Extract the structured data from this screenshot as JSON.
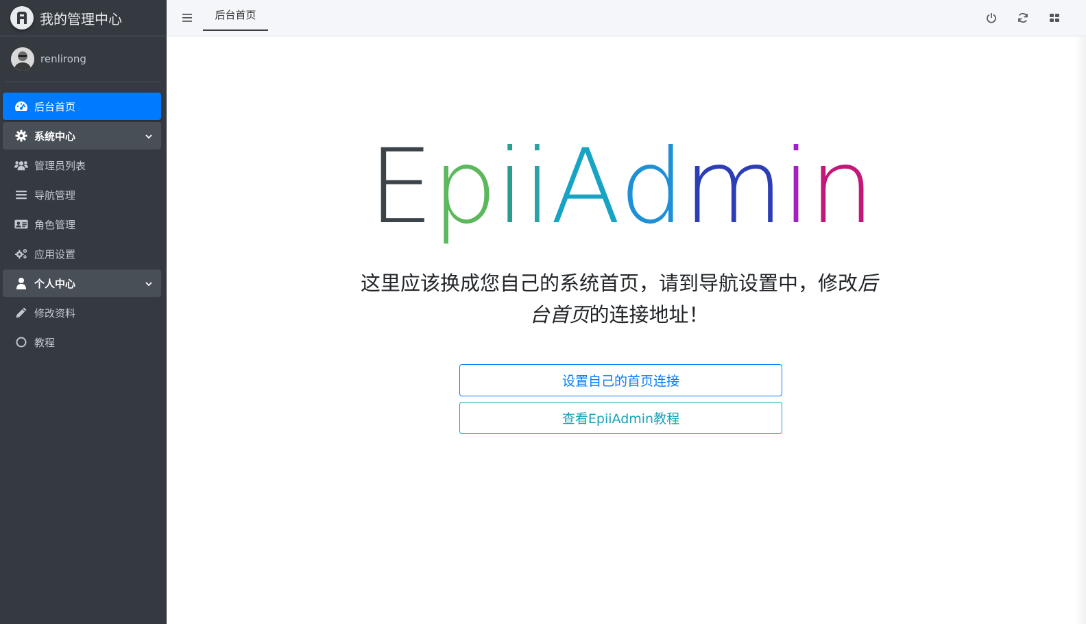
{
  "brand": {
    "title": "我的管理中心",
    "logo_letter": "R"
  },
  "user": {
    "name": "renlirong"
  },
  "sidebar": {
    "items": [
      {
        "label": "后台首页",
        "icon": "dashboard-icon",
        "state": "active"
      },
      {
        "label": "系统中心",
        "icon": "gear-icon",
        "state": "open"
      },
      {
        "label": "管理员列表",
        "icon": "users-icon",
        "state": "normal"
      },
      {
        "label": "导航管理",
        "icon": "bars-icon",
        "state": "normal"
      },
      {
        "label": "角色管理",
        "icon": "id-card-icon",
        "state": "normal"
      },
      {
        "label": "应用设置",
        "icon": "cogs-icon",
        "state": "normal"
      },
      {
        "label": "个人中心",
        "icon": "user-icon",
        "state": "open"
      },
      {
        "label": "修改资料",
        "icon": "pencil-icon",
        "state": "normal"
      },
      {
        "label": "教程",
        "icon": "circle-icon",
        "state": "normal"
      }
    ]
  },
  "header": {
    "tab_label": "后台首页",
    "icons": [
      "menu-icon",
      "power-icon",
      "refresh-icon",
      "grid-icon"
    ]
  },
  "main": {
    "logo_letters": [
      "E",
      "p",
      "i",
      "i",
      "A",
      "d",
      "m",
      "i",
      "n"
    ],
    "desc_line1_plain": "这里应该换成您自己的系统首页，请到导航设置中，修改",
    "desc_line1_italic": "后",
    "desc_line2_italic": "台首页",
    "desc_line2_plain": "的连接地址！",
    "button_primary": "设置自己的首页连接",
    "button_info": "查看EpiiAdmin教程"
  },
  "colors": {
    "sidebar_bg": "#343a40",
    "active_blue": "#007bff",
    "info_teal": "#17a2b8",
    "logo_gradient": [
      "#3d4449",
      "#5cb85c",
      "#2a9d8f",
      "#16a3c4",
      "#1f6fd1",
      "#2c3eb5",
      "#a020c4",
      "#c2187a"
    ]
  }
}
